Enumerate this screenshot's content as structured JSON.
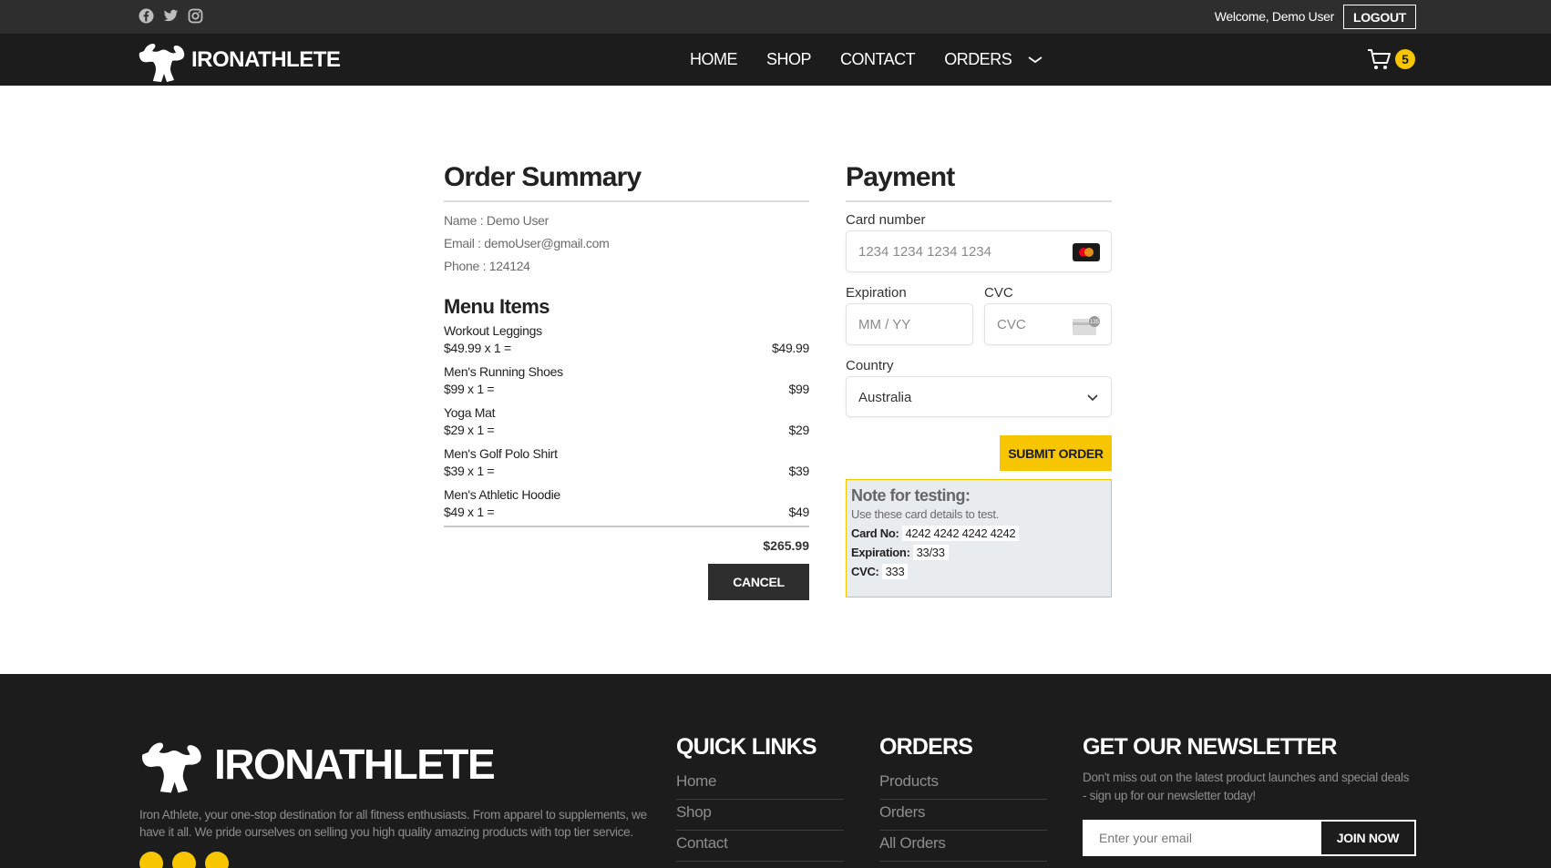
{
  "topbar": {
    "social": [
      "facebook-icon",
      "twitter-icon",
      "instagram-icon"
    ],
    "welcome": "Welcome, Demo User",
    "logout_label": "LOGOUT"
  },
  "header": {
    "brand": "IRONATHLETE",
    "nav": [
      "HOME",
      "SHOP",
      "CONTACT",
      "ORDERS"
    ],
    "cart_count": "5"
  },
  "order_summary": {
    "title": "Order Summary",
    "name": "Name : Demo User",
    "email": "Email : demoUser@gmail.com",
    "phone": "Phone : 124124",
    "menu_title": "Menu Items",
    "items": [
      {
        "name": "Workout Leggings",
        "calc": "$49.99 x 1 =",
        "total": "$49.99"
      },
      {
        "name": "Men's Running Shoes",
        "calc": "$99 x 1 =",
        "total": "$99"
      },
      {
        "name": "Yoga Mat",
        "calc": "$29 x 1 =",
        "total": "$29"
      },
      {
        "name": "Men's Golf Polo Shirt",
        "calc": "$39 x 1 =",
        "total": "$39"
      },
      {
        "name": "Men's Athletic Hoodie",
        "calc": "$49 x 1 =",
        "total": "$49"
      }
    ],
    "grand_total": "$265.99",
    "cancel_label": "CANCEL"
  },
  "payment": {
    "title": "Payment",
    "card_label": "Card number",
    "card_placeholder": "1234 1234 1234 1234",
    "exp_label": "Expiration",
    "exp_placeholder": "MM / YY",
    "cvc_label": "CVC",
    "cvc_placeholder": "CVC",
    "country_label": "Country",
    "country_value": "Australia",
    "submit_label": "SUBMIT ORDER",
    "note": {
      "title": "Note for testing:",
      "subtitle": "Use these card details to test.",
      "card_no_label": "Card No:",
      "card_no": "4242 4242 4242 4242",
      "expiration_label": "Expiration:",
      "expiration": "33/33",
      "cvc_label": "CVC:",
      "cvc": "333"
    }
  },
  "footer": {
    "brand": "IRONATHLETE",
    "description": "Iron Athlete, your one-stop destination for all fitness enthusiasts. From apparel to supplements, we have it all. We pride ourselves on selling you high quality amazing products with top tier service.",
    "quick_links_title": "QUICK LINKS",
    "quick_links": [
      "Home",
      "Shop",
      "Contact"
    ],
    "orders_title": "ORDERS",
    "orders_links": [
      "Products",
      "Orders",
      "All Orders"
    ],
    "newsletter_title": "GET OUR NEWSLETTER",
    "newsletter_text": "Don't miss out on the latest product launches and special deals - sign up for our newsletter today!",
    "newsletter_placeholder": "Enter your email",
    "join_label": "JOIN NOW"
  },
  "colors": {
    "accent": "#f7c600",
    "header_bg": "#1c1c1c",
    "topbar_bg": "#2e2e2e"
  }
}
